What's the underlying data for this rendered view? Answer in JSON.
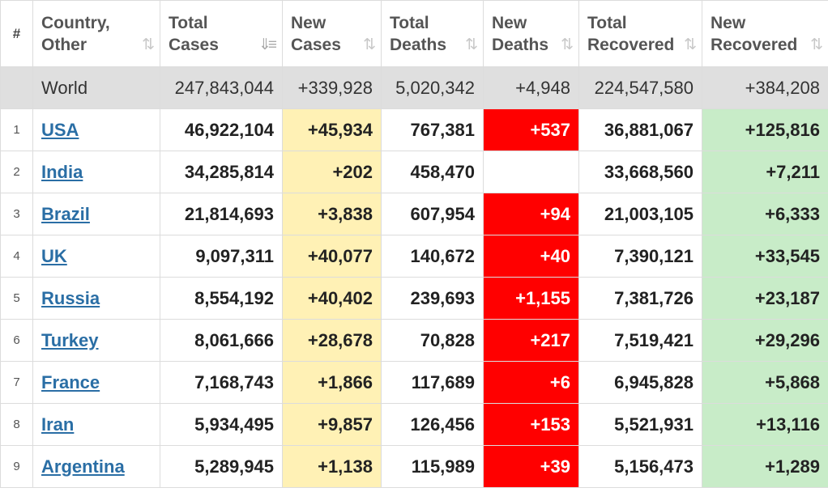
{
  "header": {
    "num": "#",
    "country": [
      "Country,",
      "Other"
    ],
    "total_cases": [
      "Total",
      "Cases"
    ],
    "new_cases": [
      "New",
      "Cases"
    ],
    "total_deaths": [
      "Total",
      "Deaths"
    ],
    "new_deaths": [
      "New",
      "Deaths"
    ],
    "total_recovered": [
      "Total",
      "Recovered"
    ],
    "new_recovered": [
      "New",
      "Recovered"
    ],
    "sort_icon": "⇅",
    "sort_active_icon": "⇓≡"
  },
  "world": {
    "name": "World",
    "total_cases": "247,843,044",
    "new_cases": "+339,928",
    "total_deaths": "5,020,342",
    "new_deaths": "+4,948",
    "total_recovered": "224,547,580",
    "new_recovered": "+384,208"
  },
  "rows": [
    {
      "idx": "1",
      "name": "USA",
      "total_cases": "46,922,104",
      "new_cases": "+45,934",
      "total_deaths": "767,381",
      "new_deaths": "+537",
      "total_recovered": "36,881,067",
      "new_recovered": "+125,816"
    },
    {
      "idx": "2",
      "name": "India",
      "total_cases": "34,285,814",
      "new_cases": "+202",
      "total_deaths": "458,470",
      "new_deaths": "",
      "total_recovered": "33,668,560",
      "new_recovered": "+7,211"
    },
    {
      "idx": "3",
      "name": "Brazil",
      "total_cases": "21,814,693",
      "new_cases": "+3,838",
      "total_deaths": "607,954",
      "new_deaths": "+94",
      "total_recovered": "21,003,105",
      "new_recovered": "+6,333"
    },
    {
      "idx": "4",
      "name": "UK",
      "total_cases": "9,097,311",
      "new_cases": "+40,077",
      "total_deaths": "140,672",
      "new_deaths": "+40",
      "total_recovered": "7,390,121",
      "new_recovered": "+33,545"
    },
    {
      "idx": "5",
      "name": "Russia",
      "total_cases": "8,554,192",
      "new_cases": "+40,402",
      "total_deaths": "239,693",
      "new_deaths": "+1,155",
      "total_recovered": "7,381,726",
      "new_recovered": "+23,187"
    },
    {
      "idx": "6",
      "name": "Turkey",
      "total_cases": "8,061,666",
      "new_cases": "+28,678",
      "total_deaths": "70,828",
      "new_deaths": "+217",
      "total_recovered": "7,519,421",
      "new_recovered": "+29,296"
    },
    {
      "idx": "7",
      "name": "France",
      "total_cases": "7,168,743",
      "new_cases": "+1,866",
      "total_deaths": "117,689",
      "new_deaths": "+6",
      "total_recovered": "6,945,828",
      "new_recovered": "+5,868"
    },
    {
      "idx": "8",
      "name": "Iran",
      "total_cases": "5,934,495",
      "new_cases": "+9,857",
      "total_deaths": "126,456",
      "new_deaths": "+153",
      "total_recovered": "5,521,931",
      "new_recovered": "+13,116"
    },
    {
      "idx": "9",
      "name": "Argentina",
      "total_cases": "5,289,945",
      "new_cases": "+1,138",
      "total_deaths": "115,989",
      "new_deaths": "+39",
      "total_recovered": "5,156,473",
      "new_recovered": "+1,289"
    }
  ],
  "colors": {
    "new_cases_bg": "#fff1b5",
    "new_deaths_bg": "#ff0000",
    "new_recovered_bg": "#c8ecc8",
    "world_row_bg": "#dfdfdf",
    "link": "#2a6ea5"
  }
}
